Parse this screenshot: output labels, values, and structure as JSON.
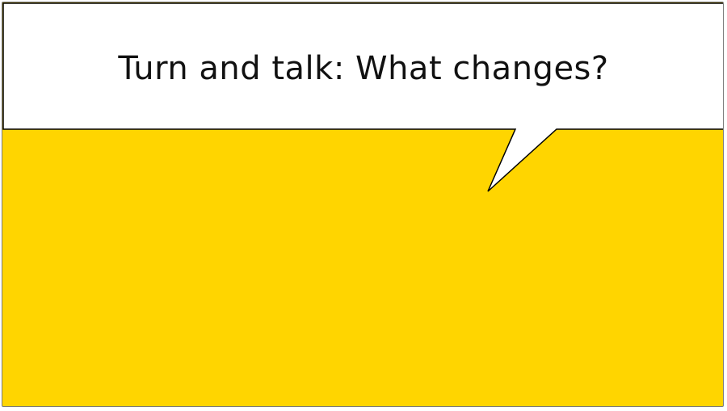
{
  "slide": {
    "prompt": "Turn and talk: What changes?",
    "background_color": "#ffd500",
    "bubble_fill": "#ffffff",
    "bubble_stroke": "#000000"
  }
}
